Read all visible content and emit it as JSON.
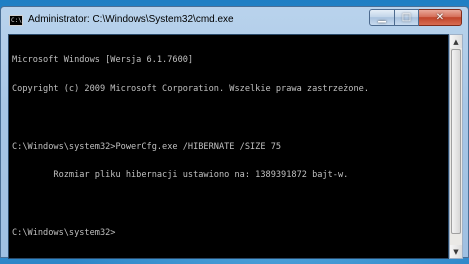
{
  "window": {
    "title": "Administrator: C:\\Windows\\System32\\cmd.exe",
    "app_icon_text": "C:\\"
  },
  "controls": {
    "minimize_glyph": "▁",
    "maximize_glyph": "□",
    "close_glyph": "✕"
  },
  "console": {
    "lines": [
      "Microsoft Windows [Wersja 6.1.7600]",
      "Copyright (c) 2009 Microsoft Corporation. Wszelkie prawa zastrzeżone.",
      "",
      "C:\\Windows\\system32>PowerCfg.exe /HIBERNATE /SIZE 75",
      "        Rozmiar pliku hibernacji ustawiono na: 1389391872 bajt-w.",
      "",
      "C:\\Windows\\system32>"
    ]
  },
  "scrollbar": {
    "up_glyph": "▲",
    "down_glyph": "▼"
  },
  "colors": {
    "console_bg": "#000000",
    "console_text": "#c0c0c0",
    "close_button": "#c0442a"
  }
}
